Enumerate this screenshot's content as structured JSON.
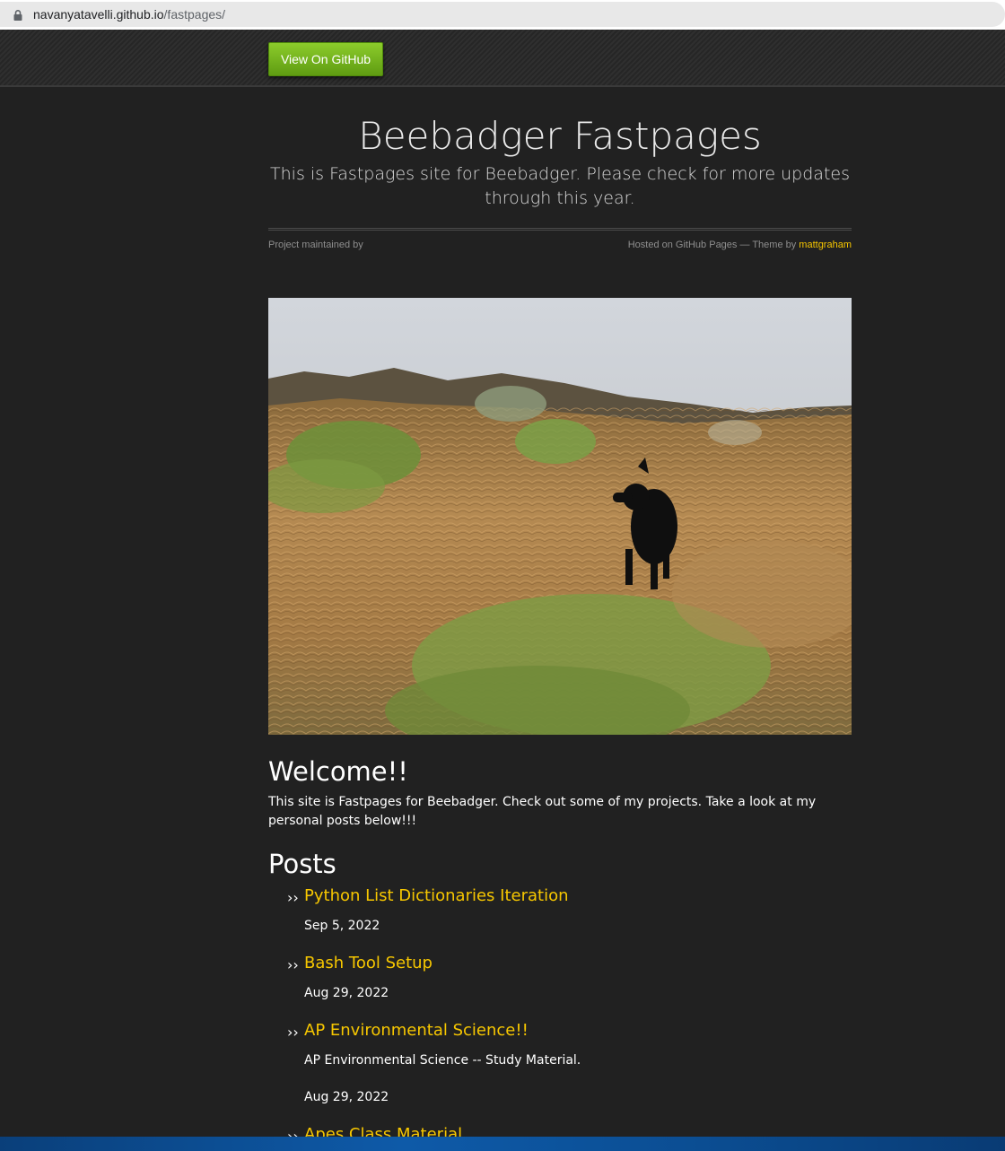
{
  "browser": {
    "url_host": "navanyatavelli.github.io",
    "url_path": "/fastpages/"
  },
  "header": {
    "github_button_label": "View On GitHub",
    "title": "Beebadger Fastpages",
    "description": "This is Fastpages site for Beebadger. Please check for more updates through this year.",
    "maintained_by": "Project maintained by",
    "hosted_prefix": "Hosted on GitHub Pages — Theme by ",
    "theme_author": "mattgraham"
  },
  "main": {
    "welcome_heading": "Welcome!!",
    "intro_text": "This site is Fastpages for Beebadger. Check out some of my projects. Take a look at my personal posts below!!!",
    "posts_heading": "Posts",
    "bullet": "››",
    "posts": [
      {
        "title": "Python List Dictionaries Iteration",
        "description": "",
        "date": "Sep 5, 2022"
      },
      {
        "title": "Bash Tool Setup",
        "description": "",
        "date": "Aug 29, 2022"
      },
      {
        "title": "AP Environmental Science!!",
        "description": "AP Environmental Science -- Study Material.",
        "date": "Aug 29, 2022"
      },
      {
        "title": "Apes Class Material",
        "description": "",
        "date": ""
      }
    ]
  },
  "colors": {
    "background": "#212121",
    "link": "#f7c700",
    "button_green": "#6fb01c"
  },
  "icons": {
    "lock": "lock-icon"
  }
}
